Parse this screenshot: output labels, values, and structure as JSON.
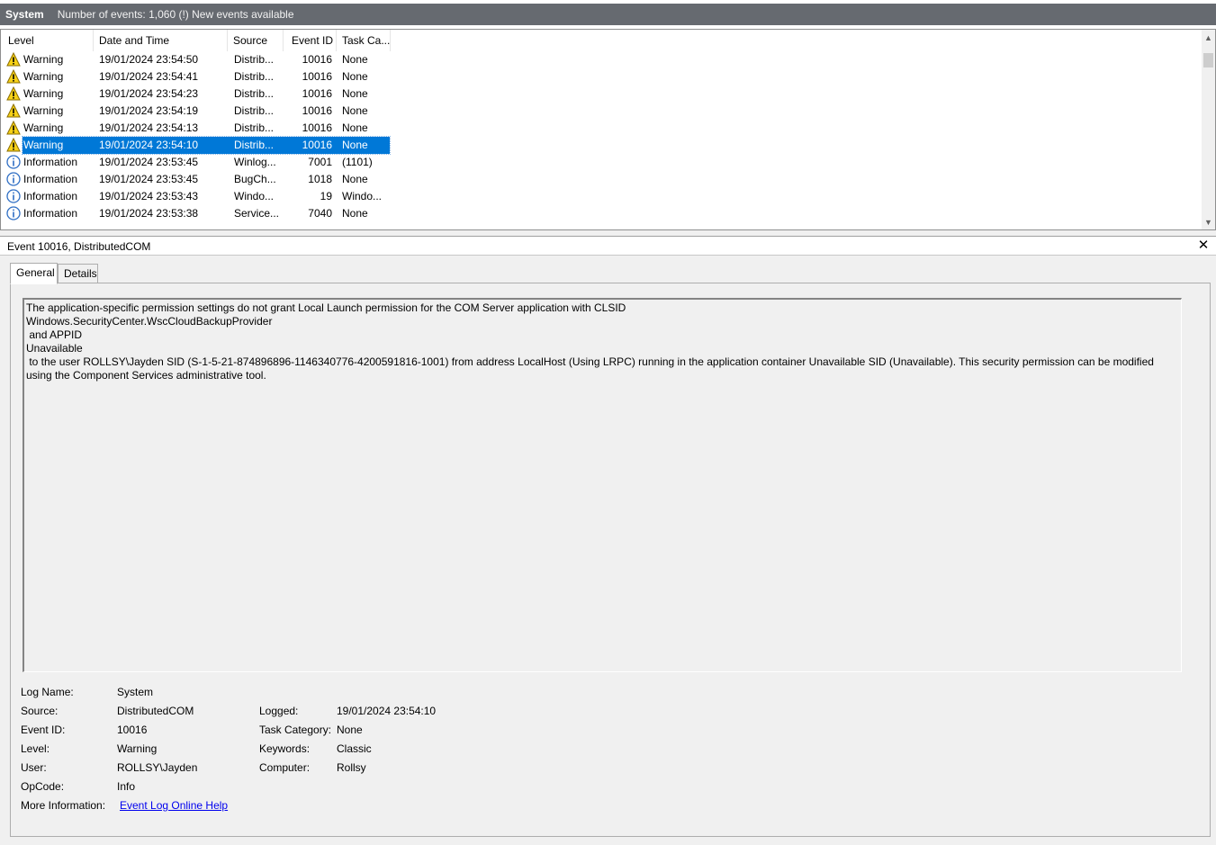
{
  "header": {
    "title": "System",
    "event_count": "Number of events: 1,060 (!) New events available"
  },
  "columns": [
    "Level",
    "Date and Time",
    "Source",
    "Event ID",
    "Task Ca..."
  ],
  "events": [
    {
      "level": "Warning",
      "icon": "warning-icon",
      "datetime": "19/01/2024 23:54:50",
      "source": "Distrib...",
      "event_id": "10016",
      "task": "None"
    },
    {
      "level": "Warning",
      "icon": "warning-icon",
      "datetime": "19/01/2024 23:54:41",
      "source": "Distrib...",
      "event_id": "10016",
      "task": "None"
    },
    {
      "level": "Warning",
      "icon": "warning-icon",
      "datetime": "19/01/2024 23:54:23",
      "source": "Distrib...",
      "event_id": "10016",
      "task": "None"
    },
    {
      "level": "Warning",
      "icon": "warning-icon",
      "datetime": "19/01/2024 23:54:19",
      "source": "Distrib...",
      "event_id": "10016",
      "task": "None"
    },
    {
      "level": "Warning",
      "icon": "warning-icon",
      "datetime": "19/01/2024 23:54:13",
      "source": "Distrib...",
      "event_id": "10016",
      "task": "None"
    },
    {
      "level": "Warning",
      "icon": "warning-icon",
      "datetime": "19/01/2024 23:54:10",
      "source": "Distrib...",
      "event_id": "10016",
      "task": "None",
      "selected": true
    },
    {
      "level": "Information",
      "icon": "info-icon",
      "datetime": "19/01/2024 23:53:45",
      "source": "Winlog...",
      "event_id": "7001",
      "task": "(1101)"
    },
    {
      "level": "Information",
      "icon": "info-icon",
      "datetime": "19/01/2024 23:53:45",
      "source": "BugCh...",
      "event_id": "1018",
      "task": "None"
    },
    {
      "level": "Information",
      "icon": "info-icon",
      "datetime": "19/01/2024 23:53:43",
      "source": "Windo...",
      "event_id": "19",
      "task": "Windo..."
    },
    {
      "level": "Information",
      "icon": "info-icon",
      "datetime": "19/01/2024 23:53:38",
      "source": "Service...",
      "event_id": "7040",
      "task": "None"
    }
  ],
  "detail": {
    "title": "Event 10016, DistributedCOM",
    "tabs": [
      "General",
      "Details"
    ],
    "message": "The application-specific permission settings do not grant Local Launch permission for the COM Server application with CLSID \nWindows.SecurityCenter.WscCloudBackupProvider\n and APPID \nUnavailable\n to the user ROLLSY\\Jayden SID (S-1-5-21-874896896-1146340776-4200591816-1001) from address LocalHost (Using LRPC) running in the application container Unavailable SID (Unavailable). This security permission can be modified using the Component Services administrative tool.",
    "props": {
      "log_name_label": "Log Name:",
      "log_name": "System",
      "source_label": "Source:",
      "source": "DistributedCOM",
      "logged_label": "Logged:",
      "logged": "19/01/2024 23:54:10",
      "event_id_label": "Event ID:",
      "event_id": "10016",
      "task_category_label": "Task Category:",
      "task_category": "None",
      "level_label": "Level:",
      "level": "Warning",
      "keywords_label": "Keywords:",
      "keywords": "Classic",
      "user_label": "User:",
      "user": "ROLLSY\\Jayden",
      "computer_label": "Computer:",
      "computer": "Rollsy",
      "opcode_label": "OpCode:",
      "opcode": "Info",
      "more_info_label": "More Information:",
      "more_info_link": "Event Log Online Help"
    }
  },
  "colors": {
    "header_bar": "#666a70",
    "selection": "#0078d7",
    "link": "#0000ee",
    "warning_yellow": "#f7d117",
    "info_blue": "#2e6ec4"
  }
}
